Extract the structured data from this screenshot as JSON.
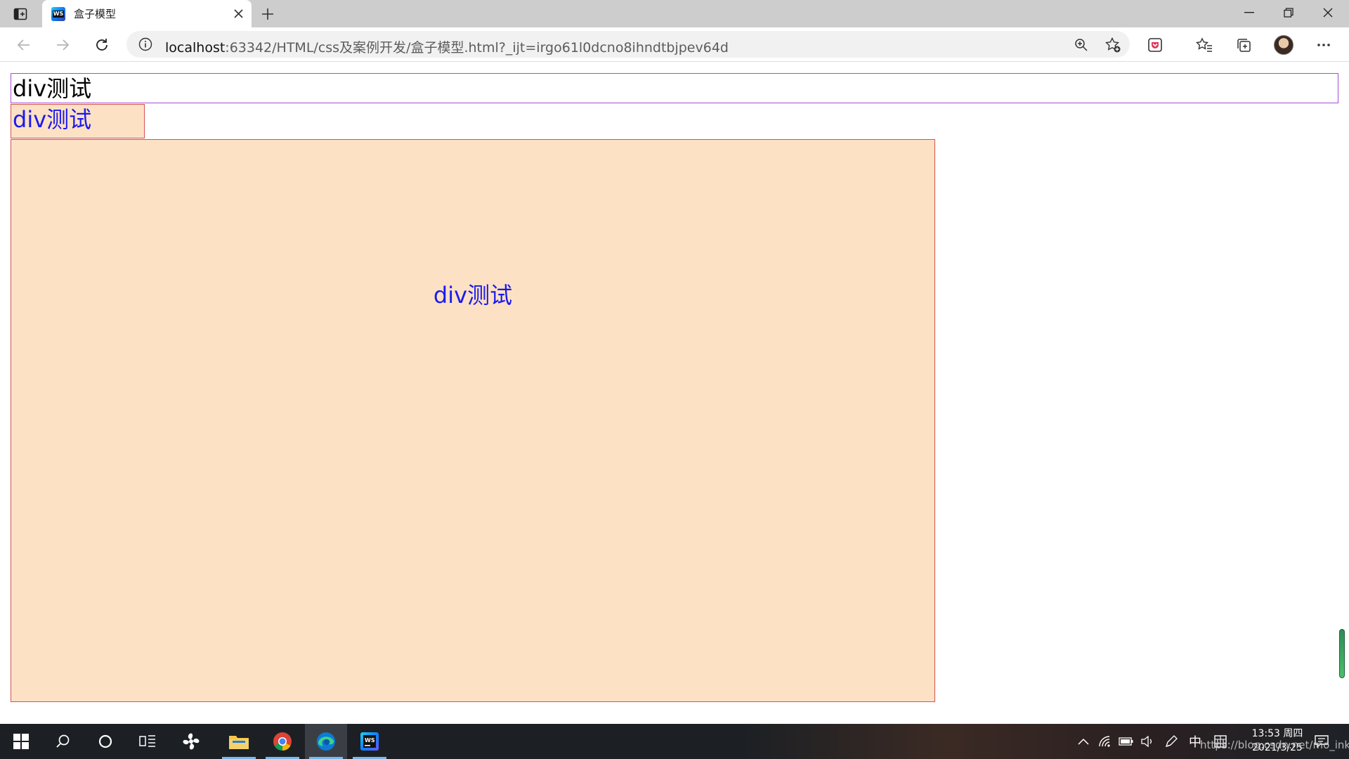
{
  "browser": {
    "tab": {
      "title": "盒子模型",
      "favicon": "WS"
    },
    "address": {
      "host": "localhost",
      "path": ":63342/HTML/css及案例开发/盒子模型.html?_ijt=irgo61l0dcno8ihndtbjpev64d"
    }
  },
  "page": {
    "box1_text": "div测试",
    "box2_text": "div测试",
    "box3_text": "div测试"
  },
  "taskbar": {
    "ime": "中",
    "time": "13:53 周四",
    "date": "2021/3/25"
  },
  "watermark": "https://blog.csdn.net/mo_ink",
  "colors": {
    "box_fill": "#fde1c4",
    "box_border": "#d45252",
    "box1_border": "#a34cd6",
    "text_blue": "#1a1aee"
  }
}
